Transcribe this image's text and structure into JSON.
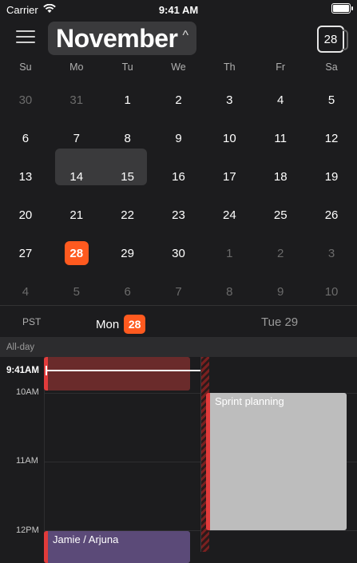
{
  "status": {
    "carrier": "Carrier",
    "time": "9:41 AM"
  },
  "header": {
    "month": "November",
    "today_number": "28"
  },
  "weekdays": [
    "Su",
    "Mo",
    "Tu",
    "We",
    "Th",
    "Fr",
    "Sa"
  ],
  "weeks": [
    [
      "30",
      "31",
      "1",
      "2",
      "3",
      "4",
      "5"
    ],
    [
      "6",
      "7",
      "8",
      "9",
      "10",
      "11",
      "12"
    ],
    [
      "13",
      "14",
      "15",
      "16",
      "17",
      "18",
      "19"
    ],
    [
      "20",
      "21",
      "22",
      "23",
      "24",
      "25",
      "26"
    ],
    [
      "27",
      "28",
      "29",
      "30",
      "1",
      "2",
      "3"
    ],
    [
      "4",
      "5",
      "6",
      "7",
      "8",
      "9",
      "10"
    ]
  ],
  "day_header": {
    "timezone": "PST",
    "mon_label": "Mon",
    "mon_number": "28",
    "tue_label": "Tue 29"
  },
  "allday_label": "All-day",
  "times": {
    "now": "9:41AM",
    "h10": "10AM",
    "h11": "11AM",
    "h12": "12PM"
  },
  "events": {
    "sprint": "Sprint planning",
    "jamie": "Jamie / Arjuna"
  },
  "colors": {
    "accent": "#ff5a1f",
    "event_red": "#e13b3b"
  }
}
